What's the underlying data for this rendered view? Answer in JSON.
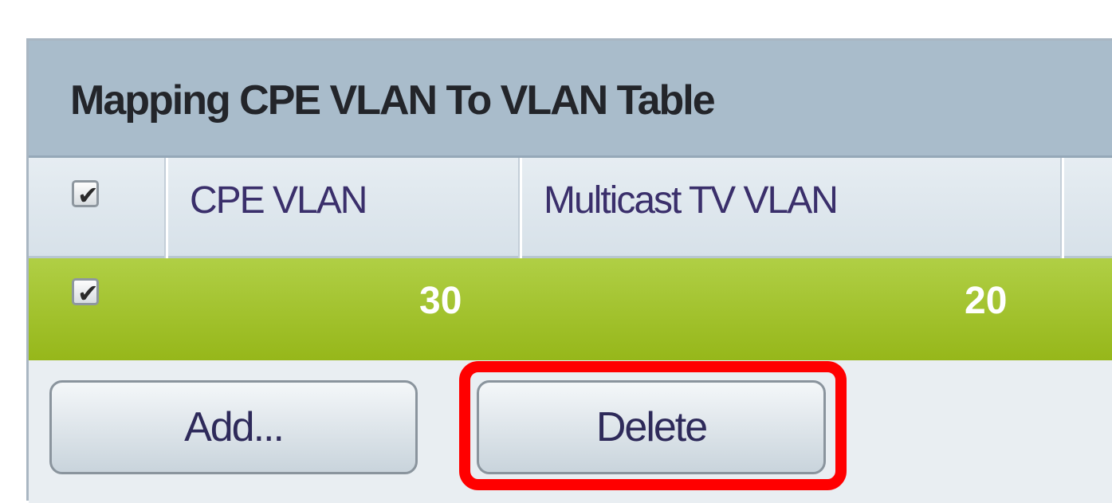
{
  "table": {
    "title": "Mapping CPE VLAN To VLAN Table",
    "columns": [
      "CPE VLAN",
      "Multicast TV VLAN"
    ],
    "rows": [
      {
        "selected": true,
        "cpe_vlan": "30",
        "multicast_tv_vlan": "20"
      }
    ],
    "header_checkbox_checked": true
  },
  "buttons": {
    "add_label": "Add...",
    "delete_label": "Delete"
  },
  "colors": {
    "selected_row": "#9dbd2a",
    "highlight": "#ff0000",
    "title_bar": "#a9bccb"
  },
  "icons": {
    "checkmark": "checkmark-icon"
  }
}
